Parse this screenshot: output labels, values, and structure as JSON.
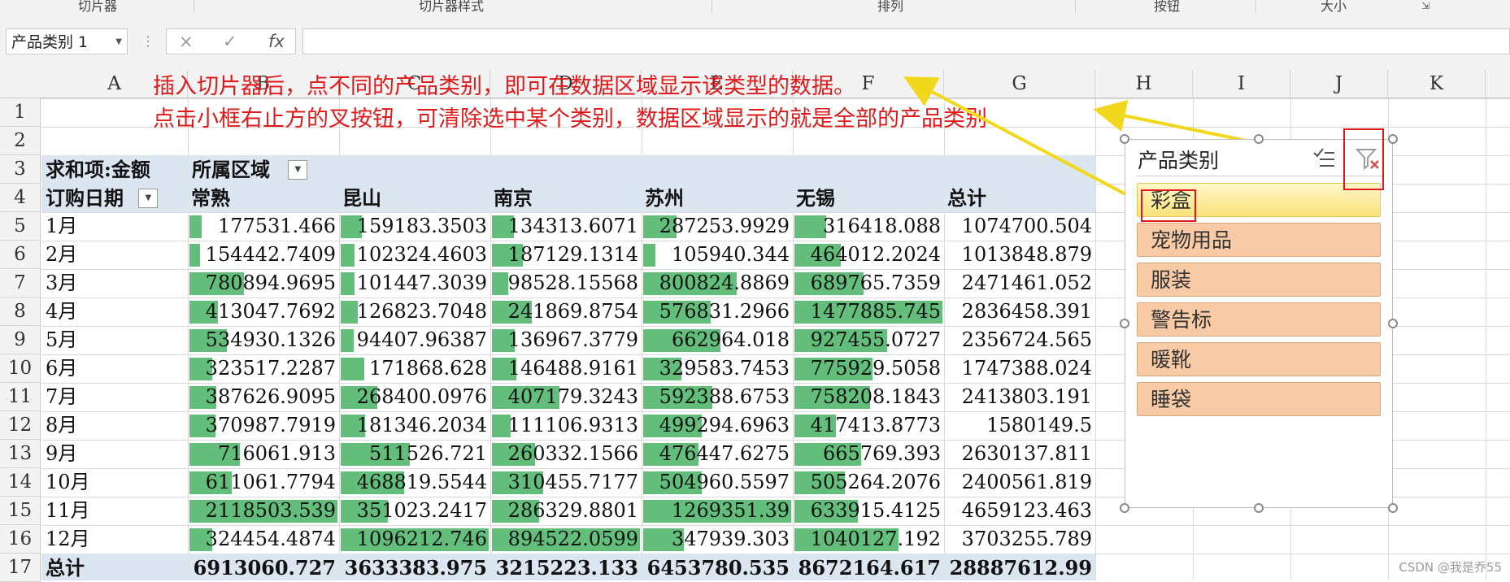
{
  "ribbon": {
    "groups": [
      "切片器",
      "切片器样式",
      "排列",
      "按钮",
      "大小"
    ]
  },
  "formula_bar": {
    "name_box": "产品类别 1",
    "cancel_icon": "×",
    "enter_icon": "✓",
    "fx_label": "fx",
    "formula": ""
  },
  "columns": [
    "A",
    "B",
    "C",
    "D",
    "E",
    "F",
    "G",
    "H",
    "I",
    "J",
    "K"
  ],
  "rows": [
    "1",
    "2",
    "3",
    "4",
    "5",
    "6",
    "7",
    "8",
    "9",
    "10",
    "11",
    "12",
    "13",
    "14",
    "15",
    "16",
    "17"
  ],
  "annotations": [
    "插入切片器后，点不同的产品类别，即可在数据区域显示该类型的数据。",
    "点击小框右止方的叉按钮，可清除选中某个类别，数据区域显示的就是全部的产品类别"
  ],
  "pivot": {
    "value_field": "求和项:金额",
    "column_field": "所属区域",
    "row_field": "订购日期",
    "column_headers": [
      "常熟",
      "昆山",
      "南京",
      "苏州",
      "无锡",
      "总计"
    ],
    "rows": [
      {
        "label": "1月",
        "values": [
          "177531.466",
          "159183.3503",
          "134313.6071",
          "287253.9929",
          "316418.088",
          "1074700.504"
        ]
      },
      {
        "label": "2月",
        "values": [
          "154442.7409",
          "102324.4603",
          "187129.1314",
          "105940.344",
          "464012.2024",
          "1013848.879"
        ]
      },
      {
        "label": "3月",
        "values": [
          "780894.9695",
          "101447.3039",
          "98528.15568",
          "800824.8869",
          "689765.7359",
          "2471461.052"
        ]
      },
      {
        "label": "4月",
        "values": [
          "413047.7692",
          "126823.7048",
          "241869.8754",
          "576831.2966",
          "1477885.745",
          "2836458.391"
        ]
      },
      {
        "label": "5月",
        "values": [
          "534930.1326",
          "94407.96387",
          "136967.3779",
          "662964.018",
          "927455.0727",
          "2356724.565"
        ]
      },
      {
        "label": "6月",
        "values": [
          "323517.2287",
          "171868.628",
          "146488.9161",
          "329583.7453",
          "775929.5058",
          "1747388.024"
        ]
      },
      {
        "label": "7月",
        "values": [
          "387626.9095",
          "268400.0976",
          "407179.3243",
          "592388.6753",
          "758208.1843",
          "2413803.191"
        ]
      },
      {
        "label": "8月",
        "values": [
          "370987.7919",
          "181346.2034",
          "111106.9313",
          "499294.6963",
          "417413.8773",
          "1580149.5"
        ]
      },
      {
        "label": "9月",
        "values": [
          "716061.913",
          "511526.721",
          "260332.1566",
          "476447.6275",
          "665769.393",
          "2630137.811"
        ]
      },
      {
        "label": "10月",
        "values": [
          "611061.7794",
          "468819.5544",
          "310455.7177",
          "504960.5597",
          "505264.2076",
          "2400561.819"
        ]
      },
      {
        "label": "11月",
        "values": [
          "2118503.539",
          "351023.2417",
          "286329.8801",
          "1269351.39",
          "633915.4125",
          "4659123.463"
        ]
      },
      {
        "label": "12月",
        "values": [
          "324454.4874",
          "1096212.746",
          "894522.0599",
          "347939.303",
          "1040127.192",
          "3703255.789"
        ]
      }
    ],
    "total_label": "总计",
    "totals": [
      "6913060.727",
      "3633383.975",
      "3215223.133",
      "6453780.535",
      "8672164.617",
      "28887612.99"
    ],
    "databar_color": "#63be7b",
    "header_band_color": "#dce6f1"
  },
  "slicer": {
    "title": "产品类别",
    "multiselect_icon": "multi-select-icon",
    "clear_filter_icon": "clear-filter-icon",
    "items": [
      {
        "label": "彩盒",
        "selected": true
      },
      {
        "label": "宠物用品",
        "selected": false
      },
      {
        "label": "服装",
        "selected": false
      },
      {
        "label": "警告标",
        "selected": false
      },
      {
        "label": "暖靴",
        "selected": false
      },
      {
        "label": "睡袋",
        "selected": false
      }
    ],
    "selected_color": "#f8e27a",
    "unselected_color": "#f8cba6"
  },
  "watermark": "CSDN @我是乔55"
}
